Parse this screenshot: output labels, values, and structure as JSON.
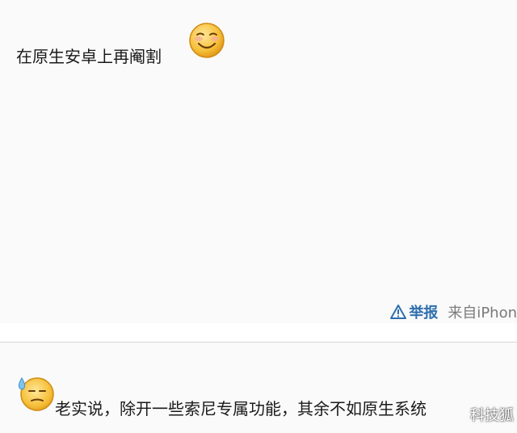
{
  "post": {
    "text": "在原生安卓上再阉割",
    "emoji_icon": "smile-emoji-icon"
  },
  "footer": {
    "report_label": "举报",
    "report_icon": "warning-triangle-icon",
    "device_label": "来自iPhon"
  },
  "reply": {
    "emoji_icon": "sweat-emoji-icon",
    "text": "老实说，除开一些索尼专属功能，其余不如原生系统"
  },
  "watermark": {
    "text": "科技狐"
  },
  "colors": {
    "link_blue": "#2f6fae",
    "muted_gray": "#7a7a7a",
    "emoji_yellow": "#f6c03a"
  }
}
